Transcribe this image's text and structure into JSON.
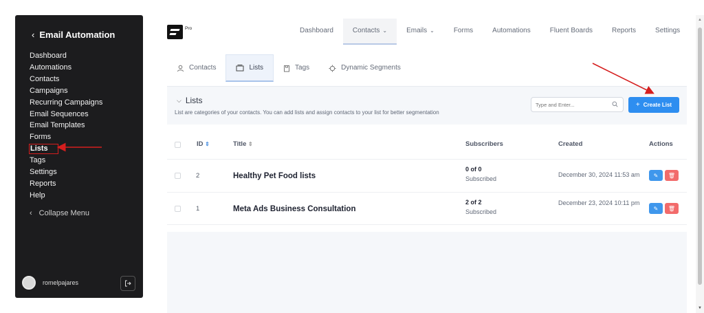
{
  "sidebar": {
    "back_chevron": "‹",
    "title": "Email Automation",
    "items": [
      {
        "label": "Dashboard"
      },
      {
        "label": "Automations"
      },
      {
        "label": "Contacts"
      },
      {
        "label": "Campaigns"
      },
      {
        "label": "Recurring Campaigns"
      },
      {
        "label": "Email Sequences"
      },
      {
        "label": "Email Templates"
      },
      {
        "label": "Forms"
      },
      {
        "label": "Lists"
      },
      {
        "label": "Tags"
      },
      {
        "label": "Settings"
      },
      {
        "label": "Reports"
      },
      {
        "label": "Help"
      }
    ],
    "collapse_label": "Collapse Menu",
    "user": "romelpajares"
  },
  "header": {
    "badge": "Pro",
    "nav": [
      {
        "label": "Dashboard"
      },
      {
        "label": "Contacts"
      },
      {
        "label": "Emails"
      },
      {
        "label": "Forms"
      },
      {
        "label": "Automations"
      },
      {
        "label": "Fluent Boards"
      },
      {
        "label": "Reports"
      },
      {
        "label": "Settings"
      }
    ]
  },
  "subtabs": [
    {
      "label": "Contacts",
      "icon": "user-icon"
    },
    {
      "label": "Lists",
      "icon": "list-icon"
    },
    {
      "label": "Tags",
      "icon": "tag-icon"
    },
    {
      "label": "Dynamic Segments",
      "icon": "segments-icon"
    }
  ],
  "panel": {
    "title": "Lists",
    "description": "List are categories of your contacts. You can add lists and assign contacts to your list for better segmentation",
    "search_placeholder": "Type and Enter...",
    "create_label": "Create List"
  },
  "table": {
    "columns": {
      "id": "ID",
      "title": "Title",
      "subscribers": "Subscribers",
      "created": "Created",
      "actions": "Actions"
    },
    "rows": [
      {
        "id": "2",
        "title": "Healthy Pet Food lists",
        "count": "0 of 0",
        "status": "Subscribed",
        "created": "December 30, 2024 11:53 am"
      },
      {
        "id": "1",
        "title": "Meta Ads Business Consultation",
        "count": "2 of 2",
        "status": "Subscribed",
        "created": "December 23, 2024 10:11 pm"
      }
    ]
  },
  "colors": {
    "sidebar_bg": "#1c1c1e",
    "primary": "#2e8ef0",
    "danger": "#f26b6b",
    "annotation": "#d51e1e"
  }
}
